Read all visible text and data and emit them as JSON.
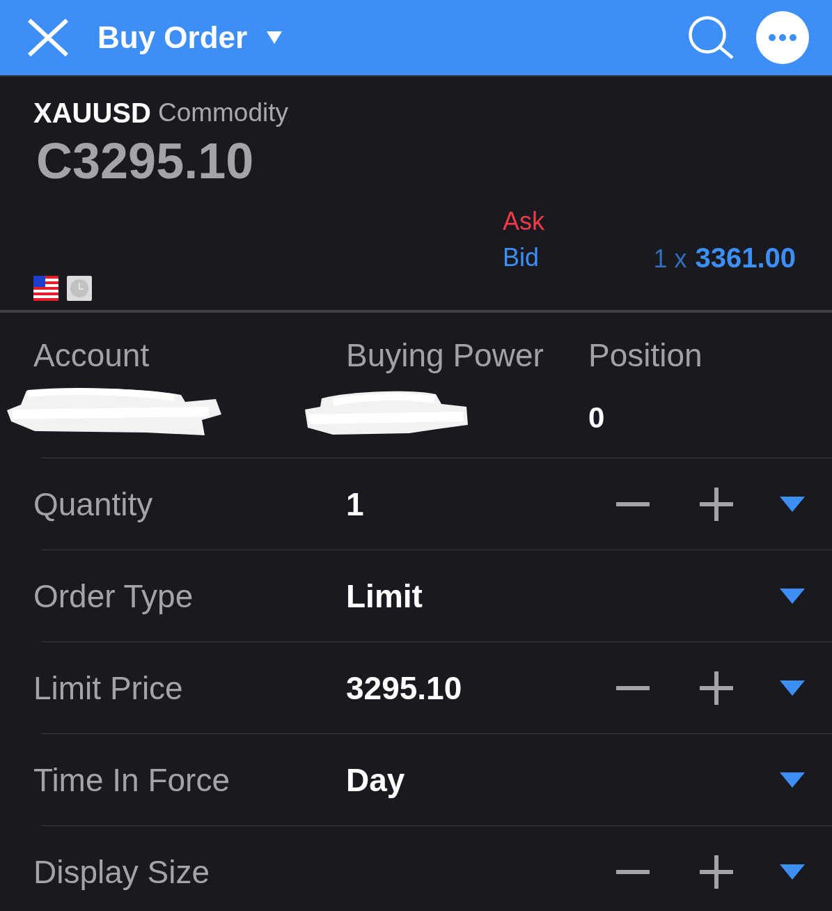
{
  "top_bar": {
    "title": "Buy Order"
  },
  "instrument": {
    "symbol": "XAUUSD",
    "type": "Commodity",
    "price": "C3295.10"
  },
  "quotes": [
    {
      "label": "Ask",
      "color": "#f0394a"
    },
    {
      "label": "Bid",
      "color": "#3d8ff5",
      "size": "1 x",
      "price": "3361.00"
    }
  ],
  "summary": [
    {
      "label": "Account",
      "redacted": true
    },
    {
      "label": "Buying Power",
      "redacted": true
    },
    {
      "label": "Position",
      "value": "0",
      "redacted": false
    }
  ],
  "fields": [
    {
      "label": "Quantity",
      "value": "1",
      "stepper": true
    },
    {
      "label": "Order Type",
      "value": "Limit",
      "stepper": false
    },
    {
      "label": "Limit Price",
      "value": "3295.10",
      "stepper": true
    },
    {
      "label": "Time In Force",
      "value": "Day",
      "stepper": false
    },
    {
      "label": "Display Size",
      "stepper": true
    }
  ]
}
